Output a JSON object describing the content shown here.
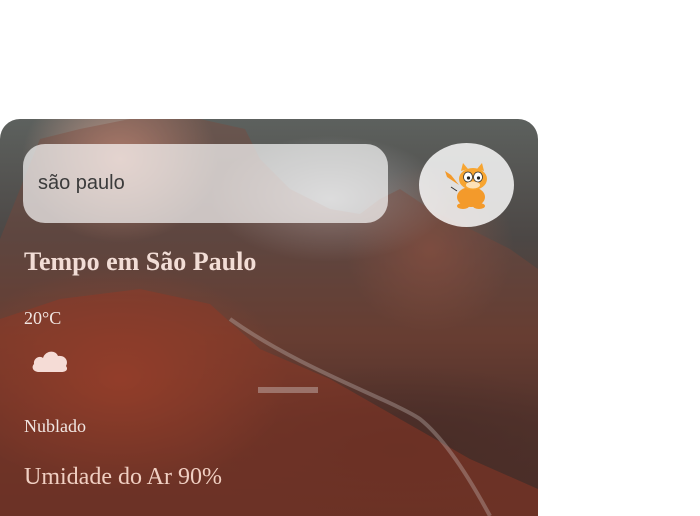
{
  "search": {
    "value": "são paulo",
    "placeholder": ""
  },
  "search_button": {
    "icon": "garfield-icon"
  },
  "weather": {
    "title": "Tempo em São Paulo",
    "temperature": "20°C",
    "condition_icon": "cloud-icon",
    "description": "Nublado",
    "humidity": "Umidade do Ar 90%"
  },
  "colors": {
    "text_light": "#f1e6e2",
    "humidity_text": "#f0cfc2",
    "search_bg": "rgba(255,255,255,0.68)"
  }
}
